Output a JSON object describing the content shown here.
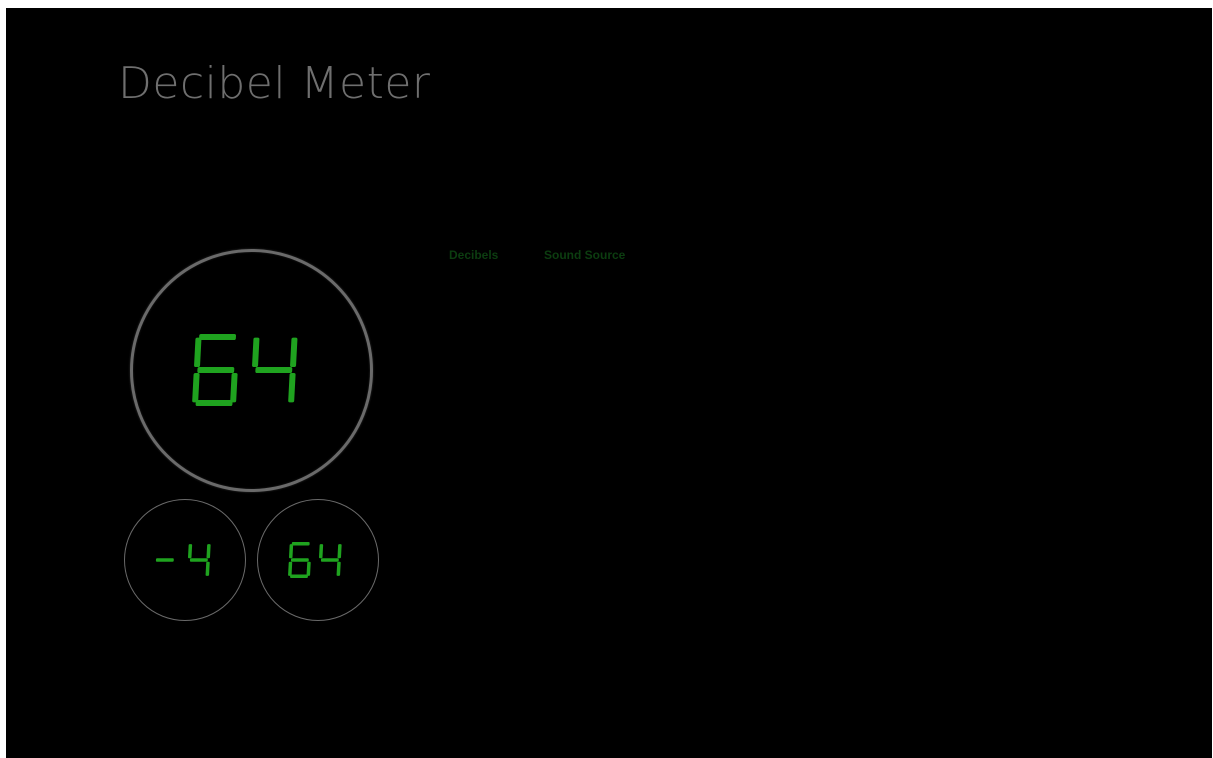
{
  "app": {
    "title": "Decibel Meter"
  },
  "meters": {
    "current": {
      "value": "64"
    },
    "min": {
      "value": "-4"
    },
    "max": {
      "value": "64"
    }
  },
  "colors": {
    "background": "#000000",
    "title": "#6f6f6f",
    "segment_green": "#1fa31f",
    "dial_ring": "#6a6a6a",
    "table_header": "#0c3d10",
    "table_text": "#1a1a1a"
  },
  "reference_table": {
    "headers": [
      "Decibels",
      "Sound Source"
    ],
    "rows": [
      [
        "",
        ""
      ],
      [
        "",
        ""
      ],
      [
        "",
        ""
      ],
      [
        "",
        ""
      ],
      [
        "",
        ""
      ],
      [
        "",
        ""
      ],
      [
        "",
        ""
      ],
      [
        "",
        ""
      ],
      [
        "",
        ""
      ],
      [
        "",
        ""
      ],
      [
        "",
        ""
      ],
      [
        "",
        ""
      ]
    ]
  }
}
